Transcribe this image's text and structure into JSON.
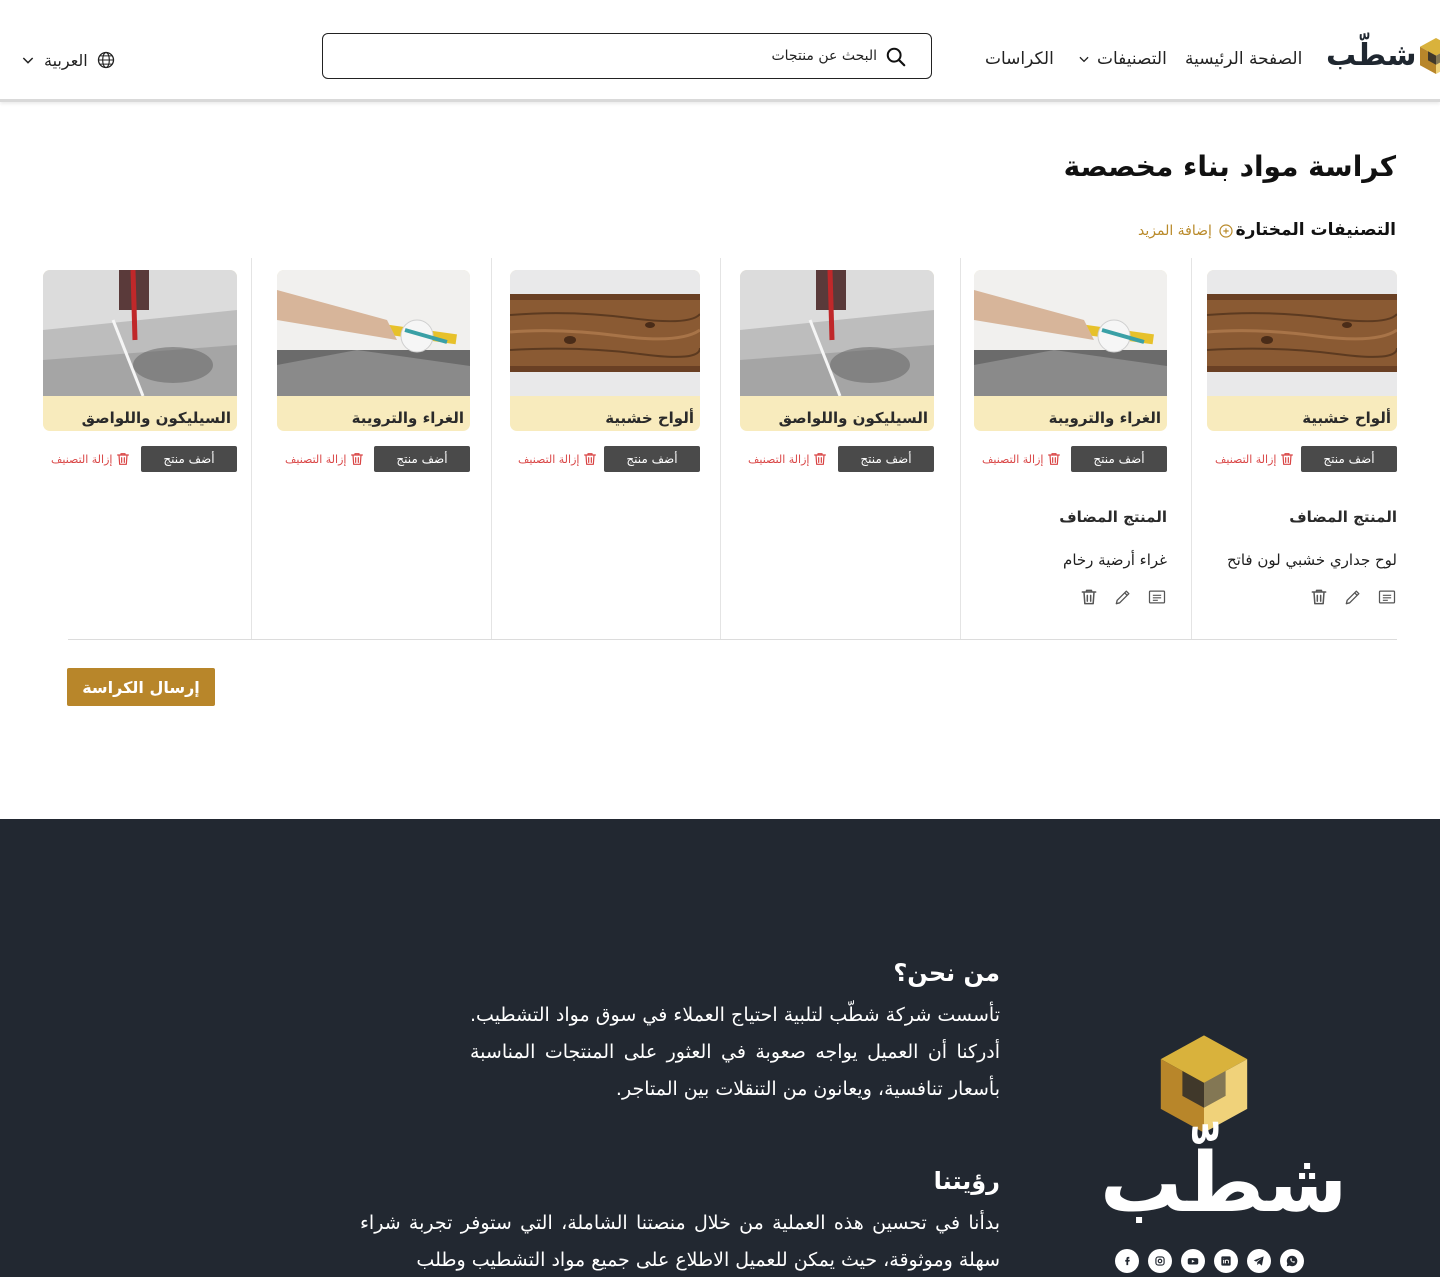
{
  "brand": {
    "name": "شطّب",
    "gold": "#b8862a",
    "dark": "#222831"
  },
  "nav": {
    "home": "الصفحة الرئيسية",
    "categories": "التصنيفات",
    "booklets": "الكراسات",
    "language": "العربية"
  },
  "search": {
    "placeholder": "البحث عن منتجات"
  },
  "page": {
    "title": "كراسة  مواد بناء مخصصة",
    "selected_categories": "التصنيفات المختارة",
    "add_more": "إضافة المزيد",
    "submit": "إرسال الكراسة"
  },
  "columns": [
    {
      "category": "ألواح خشبية",
      "image": "wood-planks",
      "add_product": "أضف منتج",
      "remove": "إزالة التصنيف",
      "added_label": "المنتج المضاف",
      "added_item": "لوح جداري خشبي لون فاتح"
    },
    {
      "category": "الغراء والترويبة",
      "image": "tile-grout",
      "add_product": "أضف منتج",
      "remove": "إزالة التصنيف",
      "added_label": "المنتج المضاف",
      "added_item": "غراء أرضية رخام"
    },
    {
      "category": "السيليكون واللواصق",
      "image": "silicone-gun",
      "add_product": "أضف منتج",
      "remove": "إزالة التصنيف"
    },
    {
      "category": "ألواح خشبية",
      "image": "wood-planks",
      "add_product": "أضف منتج",
      "remove": "إزالة التصنيف"
    },
    {
      "category": "الغراء والترويبة",
      "image": "tile-grout",
      "add_product": "أضف منتج",
      "remove": "إزالة التصنيف"
    },
    {
      "category": "السيليكون واللواصق",
      "image": "silicone-gun",
      "add_product": "أضف منتج",
      "remove": "إزالة التصنيف"
    }
  ],
  "footer": {
    "about_title": "من نحن؟",
    "about_text": "تأسست شركة شطّب لتلبية احتياج العملاء في سوق مواد التشطيب. أدركنا أن العميل يواجه صعوبة في العثور على المنتجات المناسبة بأسعار تنافسية، ويعانون من التنقلات بين المتاجر.",
    "vision_title": "رؤيتنا",
    "vision_text": "بدأنا في تحسين هذه العملية من خلال منصتنا الشاملة، التي ستوفر تجربة شراء سهلة وموثوقة، حيث يمكن للعميل الاطلاع على جميع مواد التشطيب وطلب",
    "socials": [
      "facebook-icon",
      "instagram-icon",
      "youtube-icon",
      "linkedin-icon",
      "telegram-icon",
      "whatsapp-icon"
    ]
  }
}
